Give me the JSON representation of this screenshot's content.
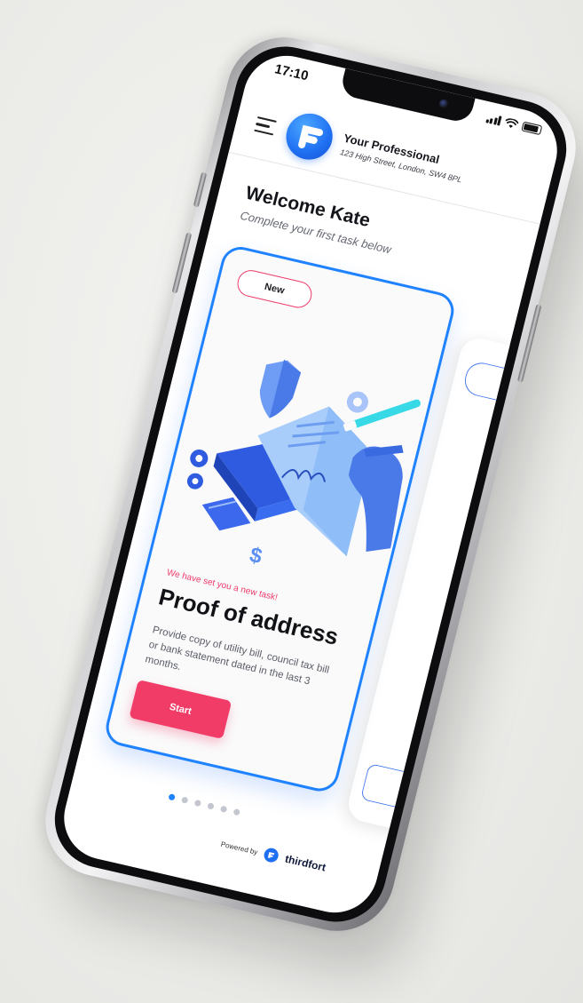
{
  "status_bar": {
    "time": "17:10"
  },
  "header": {
    "firm_name": "Your Professional",
    "firm_address": "123 High Street, London, SW4 8PL"
  },
  "welcome": {
    "title": "Welcome Kate",
    "subtitle": "Complete your first task below"
  },
  "task_card": {
    "badge": "New",
    "eyebrow": "We have set you a new task!",
    "title": "Proof of address",
    "description": "Provide copy of utility bill, council tax bill or bank statement dated in the last 3 months.",
    "start_label": "Start"
  },
  "pagination": {
    "total": 6,
    "active": 1
  },
  "footer": {
    "powered_by": "Powered by",
    "brand": "thirdfort"
  },
  "colors": {
    "accent_blue": "#1f82ff",
    "accent_pink": "#f23c68",
    "text_dark": "#14151b"
  },
  "icons": {
    "menu": "hamburger-icon",
    "logo": "firm-logo-icon",
    "brand_logo": "thirdfort-logo-icon"
  }
}
